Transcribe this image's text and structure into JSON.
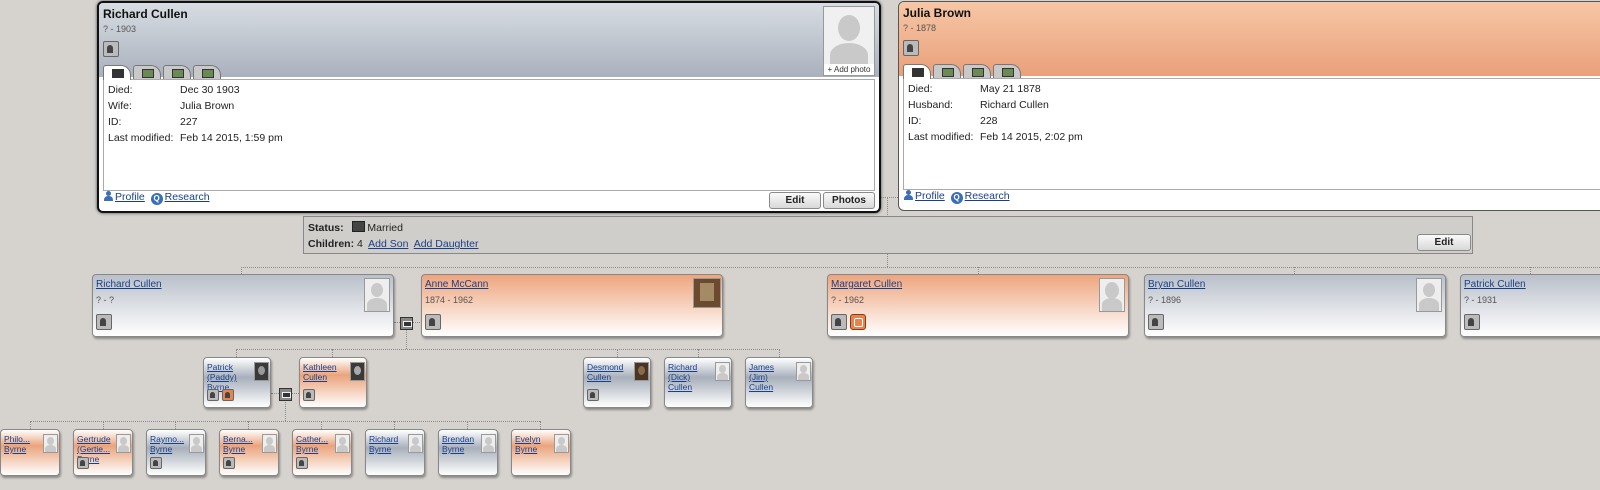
{
  "father": {
    "name": "Richard Cullen",
    "dates": "? - 1903",
    "fields": [
      {
        "k": "Died:",
        "v": "Dec 30 1903"
      },
      {
        "k": "Wife:",
        "v": "Julia Brown"
      },
      {
        "k": "ID:",
        "v": "227"
      },
      {
        "k": "Last modified:",
        "v": "Feb 14 2015, 1:59 pm"
      }
    ],
    "add_photo": "+ Add photo",
    "edit_label": "Edit",
    "photos_label": "Photos"
  },
  "mother": {
    "name": "Julia Brown",
    "dates": "? - 1878",
    "fields": [
      {
        "k": "Died:",
        "v": "May 21 1878"
      },
      {
        "k": "Husband:",
        "v": "Richard Cullen"
      },
      {
        "k": "ID:",
        "v": "228"
      },
      {
        "k": "Last modified:",
        "v": "Feb 14 2015, 2:02 pm"
      }
    ]
  },
  "links": {
    "profile": "Profile",
    "research": "Research"
  },
  "family": {
    "status_label": "Status:",
    "status_value": "Married",
    "children_label": "Children:",
    "children_count": "4",
    "add_son": "Add Son",
    "add_daughter": "Add Daughter",
    "edit_label": "Edit"
  },
  "children": [
    {
      "name": "Richard Cullen",
      "dates": "? - ?"
    },
    {
      "name": "Anne McCann",
      "dates": "1874 - 1962"
    },
    {
      "name": "Margaret Cullen",
      "dates": "? - 1962"
    },
    {
      "name": "Bryan Cullen",
      "dates": "? - 1896"
    },
    {
      "name": "Patrick Cullen",
      "dates": "? - 1931"
    }
  ],
  "grandchildren": [
    {
      "name": "Patrick (Paddy) Byrne"
    },
    {
      "name": "Kathleen Cullen"
    },
    {
      "name": "Desmond Cullen"
    },
    {
      "name": "Richard (Dick) Cullen"
    },
    {
      "name": "James (Jim) Cullen"
    }
  ],
  "great_grandchildren": [
    {
      "name": "Philo... Byrne"
    },
    {
      "name": "Gertrude (Gertie... Byrne"
    },
    {
      "name": "Raymo... Byrne"
    },
    {
      "name": "Berna... Byrne"
    },
    {
      "name": "Cather... Byrne"
    },
    {
      "name": "Richard Byrne"
    },
    {
      "name": "Brendan Byrne"
    },
    {
      "name": "Evelyn Byrne"
    }
  ],
  "colors": {
    "male_header": "#a9b1bd",
    "female_header": "#e9a07a",
    "link": "#1a3f8a",
    "background": "#d6d3cf"
  }
}
